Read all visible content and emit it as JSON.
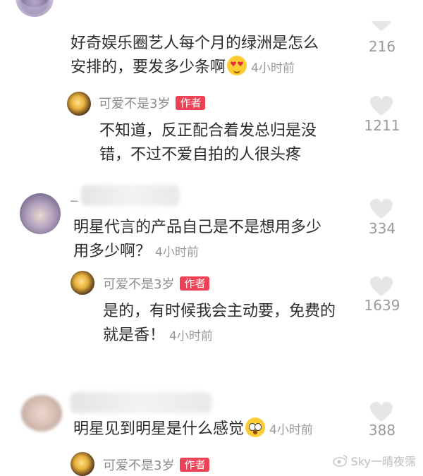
{
  "comments": [
    {
      "text_line1": "好奇娱乐圈艺人每个月的绿洲是怎么",
      "text_line2": "安排的，要发多少条啊",
      "time": "4小时前",
      "likes": "216",
      "emoji": "heart-eyes-emoji",
      "reply": {
        "author": "可爱不是3岁",
        "badge": "作者",
        "text_line1": "不知道，反正配合着发总归是没",
        "text_line2": "错，不过不爱自拍的人很头疼",
        "likes": "1211"
      }
    },
    {
      "user_name_prefix": "_",
      "text_line1": "明星代言的产品自己是不是想用多少",
      "text_line2": "用多少啊？",
      "time": "4小时前",
      "likes": "334",
      "reply": {
        "author": "可爱不是3岁",
        "badge": "作者",
        "text_line1": "是的，有时候我会主动要，免费的",
        "text_line2": "就是香！",
        "time": "4小时前",
        "likes": "1639"
      }
    },
    {
      "text_line1": "明星见到明星是什么感觉",
      "time": "4小时前",
      "likes": "388",
      "emoji": "flushed-emoji",
      "reply": {
        "author": "可爱不是3岁",
        "badge": "作者"
      }
    }
  ],
  "watermark": "Sky一晴夜霈",
  "colors": {
    "badge": "#ef4156",
    "muted": "#999999",
    "heart": "#e6e6e6"
  }
}
